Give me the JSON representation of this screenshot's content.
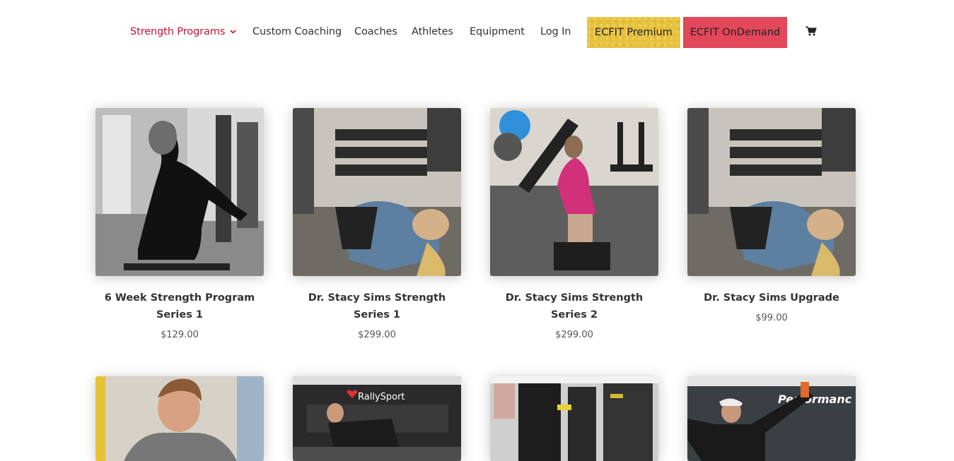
{
  "nav": {
    "items": [
      {
        "label": "Strength Programs",
        "active": true,
        "dropdown": true
      },
      {
        "label": "Custom Coaching"
      },
      {
        "label": "Coaches"
      },
      {
        "label": "Athletes"
      },
      {
        "label": "Equipment"
      },
      {
        "label": "Log In"
      }
    ],
    "premium_label": "ECFIT Premium",
    "ondemand_label": "ECFIT OnDemand",
    "cart_icon": "cart-icon",
    "chevron_icon": "chevron-down-icon"
  },
  "colors": {
    "active_nav": "#c8102e",
    "premium_button": "#e8c23c",
    "ondemand_button": "#e2475a"
  },
  "products": [
    {
      "title": "6 Week Strength Program Series 1",
      "price": "$129.00",
      "image": "woman at cable machine (black and white)"
    },
    {
      "title": "Dr. Stacy Sims Strength Series 1",
      "price": "$299.00",
      "image": "woman on leg press"
    },
    {
      "title": "Dr. Stacy Sims Strength Series 2",
      "price": "$299.00",
      "image": "woman lunging with foam roller"
    },
    {
      "title": "Dr. Stacy Sims Upgrade",
      "price": "$99.00",
      "image": "woman on leg press"
    }
  ],
  "products_row2": [
    {
      "image": "woman portrait in gym"
    },
    {
      "image": "man in RallySport gym",
      "sign_text": "RallySport"
    },
    {
      "image": "gym machines"
    },
    {
      "image": "man stretching in performance gym",
      "sign_text": "Performanc"
    }
  ]
}
